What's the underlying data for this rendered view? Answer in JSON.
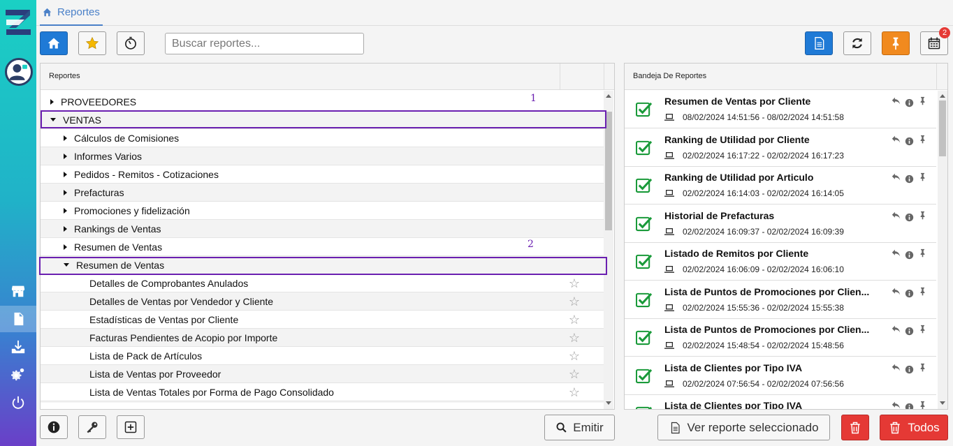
{
  "header": {
    "tab_label": "Reportes"
  },
  "search": {
    "placeholder": "Buscar reportes..."
  },
  "toolbar": {
    "notification_count": "2"
  },
  "left_panel": {
    "header": "Reportes",
    "rows": [
      {
        "label": "PROVEEDORES",
        "level": 0,
        "expanded": false,
        "leaf": false
      },
      {
        "label": "VENTAS",
        "level": 0,
        "expanded": true,
        "leaf": false
      },
      {
        "label": "Cálculos de Comisiones",
        "level": 1,
        "expanded": false,
        "leaf": false
      },
      {
        "label": "Informes Varios",
        "level": 1,
        "expanded": false,
        "leaf": false
      },
      {
        "label": "Pedidos - Remitos - Cotizaciones",
        "level": 1,
        "expanded": false,
        "leaf": false
      },
      {
        "label": "Prefacturas",
        "level": 1,
        "expanded": false,
        "leaf": false
      },
      {
        "label": "Promociones y fidelización",
        "level": 1,
        "expanded": false,
        "leaf": false
      },
      {
        "label": "Rankings de Ventas",
        "level": 1,
        "expanded": false,
        "leaf": false
      },
      {
        "label": "Resumen de Ventas",
        "level": 1,
        "expanded": false,
        "leaf": false
      },
      {
        "label": "Resumen de Ventas",
        "level": 1,
        "expanded": true,
        "leaf": false
      },
      {
        "label": "Detalles de Comprobantes Anulados",
        "level": 2,
        "leaf": true
      },
      {
        "label": "Detalles de Ventas por Vendedor y Cliente",
        "level": 2,
        "leaf": true
      },
      {
        "label": "Estadísticas de Ventas por Cliente",
        "level": 2,
        "leaf": true
      },
      {
        "label": "Facturas Pendientes de Acopio por Importe",
        "level": 2,
        "leaf": true
      },
      {
        "label": "Lista de Pack de Artículos",
        "level": 2,
        "leaf": true
      },
      {
        "label": "Lista de Ventas por Proveedor",
        "level": 2,
        "leaf": true
      },
      {
        "label": "Lista de Ventas Totales por Forma de Pago Consolidado",
        "level": 2,
        "leaf": true
      },
      {
        "label": "Lista de Ventas Totales por Forma de Pago Consolidado",
        "level": 2,
        "leaf": true
      }
    ]
  },
  "annotations": {
    "one": "1",
    "two": "2"
  },
  "right_panel": {
    "header": "Bandeja De Reportes",
    "items": [
      {
        "title": "Resumen de Ventas por Cliente",
        "time": "08/02/2024 14:51:56 - 08/02/2024 14:51:58"
      },
      {
        "title": "Ranking de Utilidad por Cliente",
        "time": "02/02/2024 16:17:22 - 02/02/2024 16:17:23"
      },
      {
        "title": "Ranking de Utilidad por Articulo",
        "time": "02/02/2024 16:14:03 - 02/02/2024 16:14:05"
      },
      {
        "title": "Historial de Prefacturas",
        "time": "02/02/2024 16:09:37 - 02/02/2024 16:09:39"
      },
      {
        "title": "Listado de Remitos por Cliente",
        "time": "02/02/2024 16:06:09 - 02/02/2024 16:06:10"
      },
      {
        "title": "Lista de Puntos de Promociones por Clien...",
        "time": "02/02/2024 15:55:36 - 02/02/2024 15:55:38"
      },
      {
        "title": "Lista de Puntos de Promociones por Clien...",
        "time": "02/02/2024 15:48:54 - 02/02/2024 15:48:56"
      },
      {
        "title": "Lista de Clientes por Tipo IVA",
        "time": "02/02/2024 07:56:54 - 02/02/2024 07:56:56"
      },
      {
        "title": "Lista de Clientes por Tipo IVA",
        "time": ""
      }
    ]
  },
  "footer": {
    "emit_label": "Emitir",
    "view_label": "Ver reporte seleccionado",
    "all_label": "Todos"
  },
  "colors": {
    "accent": "#1f7ad6",
    "highlight": "#6a1fb0",
    "danger": "#e53935",
    "pin": "#f18a1f",
    "check": "#1a9a3a"
  }
}
